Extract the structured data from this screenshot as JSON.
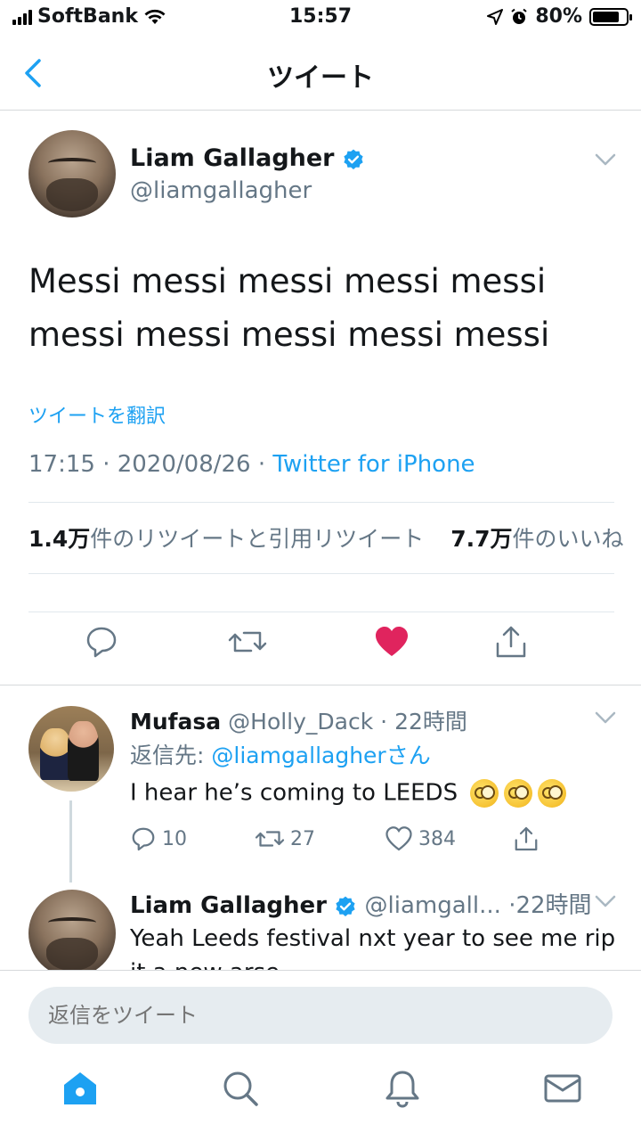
{
  "status_bar": {
    "carrier": "SoftBank",
    "time": "15:57",
    "battery": "80%",
    "battery_level": 0.8
  },
  "nav": {
    "title": "ツイート",
    "back_icon": "chevron-left-icon"
  },
  "tweet": {
    "author_name": "Liam Gallagher",
    "author_handle": "@liamgallagher",
    "text": "Messi messi messi messi messi messi messi messi messi messi",
    "translate_label": "ツイートを翻訳",
    "timestamp": "17:15 · 2020/08/26 · ",
    "source": "Twitter for iPhone",
    "retweets_count": "1.4万",
    "retweets_label": "件のリツイートと引用リツイート",
    "likes_count": "7.7万",
    "likes_label": "件のいいね",
    "like_color": "#e0245e"
  },
  "reply": {
    "author_name": "Mufasa",
    "author_handle": "@Holly_Dack",
    "time": "· 22時間",
    "replying_prefix": "返信先: ",
    "replying_to": "@liamgallagher",
    "replying_suffix": "さん",
    "text": "I hear he’s coming to LEEDS",
    "reply_count": "10",
    "retweet_count": "27",
    "like_count": "384"
  },
  "second_reply": {
    "author_name": "Liam Gallagher",
    "author_handle": "@liamgall...",
    "time": "·22時間",
    "text": "Yeah Leeds festival nxt year to see me rip it a new arse"
  },
  "reply_bar": {
    "placeholder": "返信をツイート"
  },
  "colors": {
    "accent": "#1da1f2",
    "verified": "#1da1f2",
    "muted": "#657786"
  }
}
